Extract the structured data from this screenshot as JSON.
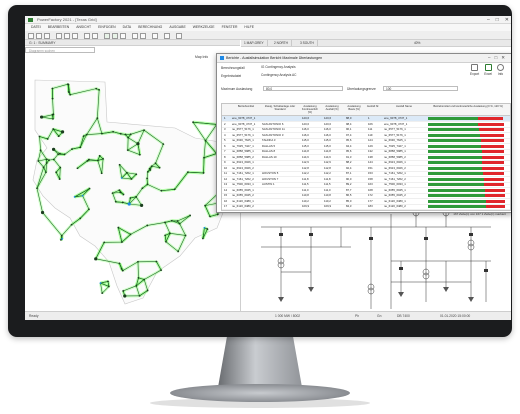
{
  "app": {
    "title": "PowerFactory 2021 - [Texas Grid]",
    "menu": [
      "DATEI",
      "BEARBEITEN",
      "ANSICHT",
      "EINFÜGEN",
      "DATA",
      "BERECHNUNG",
      "AUSGABE",
      "WERKZEUGE",
      "FENSTER",
      "HILFE"
    ],
    "window_buttons": [
      "–",
      "□",
      "✕"
    ],
    "view_tab": "G: 1 : SUMMARY",
    "search_placeholder": "Diagramm suchen",
    "map_caption": "Map Info",
    "diagram_tabs": [
      "1 MAP-GREY",
      "2 NORTH",
      "3 SOUTH"
    ],
    "zoom": "40%",
    "status": {
      "left": "Ready",
      "mid": "1 000 MW / 8002",
      "c1": "Ph",
      "c2": "Gn",
      "c3": "DB 7400",
      "time": "01.01.2020 15:00:00"
    }
  },
  "dialog": {
    "title": "Berichte - Ausfallsimulation Bericht Maximale Überlastungen",
    "window_buttons": "–□✕",
    "tools": [
      {
        "label": "Export",
        "icon": "export-icon"
      },
      {
        "label": "Excel",
        "icon": "excel-icon"
      },
      {
        "label": "Info",
        "icon": "info-icon"
      }
    ],
    "fields": [
      {
        "label": "Berechnungsfall",
        "value": "IG Contingency Analysis"
      },
      {
        "label": "Ergebnisdatei",
        "value": "Contingency Analysis AC"
      },
      {
        "label": "Maximum Auslastung",
        "value": "80,0"
      },
      {
        "label": "Überladungsgrenze",
        "value": "100"
      }
    ],
    "columns": [
      "",
      "Betriebsmittel",
      "Zweig, Schaltanlage oder Standard",
      "Auslastung Kontinuierlich [%]",
      "Auslastung Ausfall [%]",
      "Auslastung Basis [%]",
      "Ausfall Nr.",
      "Ausfall Name",
      "Betriebsmittel und kontinuierliche Auslastung [0 %, 120 %]"
    ],
    "rows": [
      {
        "n": "1",
        "name": "ene_6078_4737_1",
        "zweig": "",
        "k": "120,6",
        "a": "120,6",
        "b": "88,0",
        "nr": "1",
        "aus": "ene_6078_4737_1",
        "g": 0.62
      },
      {
        "n": "2",
        "name": "ene_6078_4737_1",
        "zweig": "SAN ANTONIO 6",
        "k": "120,0",
        "a": "120,0",
        "b": "98,4",
        "nr": "106",
        "aus": "ene_6078_4737_1",
        "g": 0.63
      },
      {
        "n": "3",
        "name": "ne_6577_5176_1",
        "zweig": "SAN ANTONIO 11",
        "k": "116,0",
        "a": "116,0",
        "b": "96,1",
        "nr": "111",
        "aus": "ne_6577_5176_1",
        "g": 0.64
      },
      {
        "n": "4",
        "name": "ne_6577_5176_1",
        "zweig": "SAN ANTONIO 3",
        "k": "116,0",
        "a": "116,0",
        "b": "97,4",
        "nr": "119",
        "aus": "ne_6577_5176_1",
        "g": 0.65
      },
      {
        "n": "5",
        "name": "ne_6630_7625_1",
        "zweig": "TAHOKA 3",
        "k": "115,0",
        "a": "115,0",
        "b": "95,6",
        "nr": "124",
        "aus": "ne_6630_7625_1",
        "g": 0.66
      },
      {
        "n": "6",
        "name": "ne_7625_7427_1",
        "zweig": "DALLAS 5",
        "k": "115,0",
        "a": "115,0",
        "b": "94,4",
        "nr": "129",
        "aus": "ne_7625_7427_1",
        "g": 0.66
      },
      {
        "n": "7",
        "name": "ne_6858_5985_1",
        "zweig": "DALLAS 8",
        "k": "114,8",
        "a": "114,8",
        "b": "95,6",
        "nr": "132",
        "aus": "ne_6858_5985_1",
        "g": 0.67
      },
      {
        "n": "8",
        "name": "ne_6858_5985_2",
        "zweig": "DALLAS 10",
        "k": "114,6",
        "a": "114,6",
        "b": "91,3",
        "nr": "138",
        "aus": "ne_6858_5985_2",
        "g": 0.67
      },
      {
        "n": "9",
        "name": "ne_6913_6026_1",
        "zweig": "",
        "k": "112,9",
        "a": "112,9",
        "b": "88,2",
        "nr": "144",
        "aus": "ne_6913_6026_1",
        "g": 0.68
      },
      {
        "n": "10",
        "name": "ne_6913_6026_2",
        "zweig": "",
        "k": "112,8",
        "a": "112,8",
        "b": "92,4",
        "nr": "151",
        "aus": "ne_6913_6026_2",
        "g": 0.68
      },
      {
        "n": "11",
        "name": "ne_7161_7262_1",
        "zweig": "HOUSTON 5",
        "k": "112,2",
        "a": "112,2",
        "b": "87,1",
        "nr": "153",
        "aus": "ne_7161_7262_1",
        "g": 0.69
      },
      {
        "n": "12",
        "name": "ne_7161_7262_2",
        "zweig": "HOUSTON 7",
        "k": "111,8",
        "a": "111,8",
        "b": "90,0",
        "nr": "158",
        "aus": "ne_7161_7262_2",
        "g": 0.7
      },
      {
        "n": "13",
        "name": "ne_7500_6033_1",
        "zweig": "AUSTIN 1",
        "k": "111,5",
        "a": "111,5",
        "b": "89,2",
        "nr": "163",
        "aus": "ne_7500_6033_1",
        "g": 0.7
      },
      {
        "n": "14",
        "name": "ne_6055_6045_1",
        "zweig": "",
        "k": "111,0",
        "a": "111,0",
        "b": "87,7",
        "nr": "168",
        "aus": "ne_6055_6045_1",
        "g": 0.71
      },
      {
        "n": "15",
        "name": "ne_6055_6045_2",
        "zweig": "",
        "k": "110,8",
        "a": "110,8",
        "b": "86,5",
        "nr": "172",
        "aus": "ne_6055_6045_2",
        "g": 0.71
      },
      {
        "n": "16",
        "name": "ne_6120_6480_1",
        "zweig": "",
        "k": "110,2",
        "a": "110,2",
        "b": "85,0",
        "nr": "177",
        "aus": "ne_6120_6480_1",
        "g": 0.72
      },
      {
        "n": "17",
        "name": "ne_6120_6480_2",
        "zweig": "",
        "k": "109,9",
        "a": "109,9",
        "b": "84,3",
        "nr": "183",
        "aus": "ne_6120_6480_2",
        "g": 0.73
      }
    ],
    "footer": "167 Zeile(n) von 167 1 Zeile(n) markiert",
    "axis_left": "0",
    "axis_right": "120"
  },
  "colors": {
    "green": "#2f9a3a",
    "red": "#e0262b",
    "grid": "#1e6b25",
    "glow": "#7dff6a",
    "accent": "#1e88e5"
  }
}
